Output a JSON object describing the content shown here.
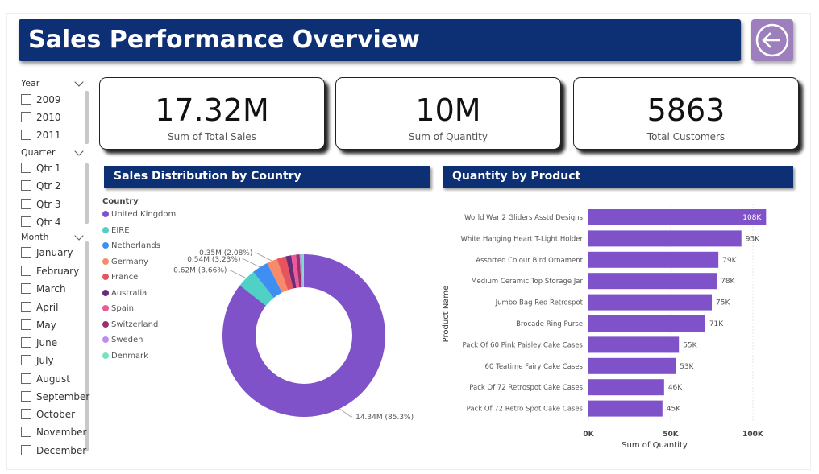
{
  "header": {
    "title": "Sales Performance Overview",
    "back_icon": "arrow-left-circle-icon"
  },
  "colors": {
    "navy": "#0d2f73",
    "purple": "#7f52c9",
    "button": "#9d7fbd"
  },
  "slicers": {
    "year": {
      "label": "Year",
      "items": [
        "2009",
        "2010",
        "2011"
      ]
    },
    "quarter": {
      "label": "Quarter",
      "items": [
        "Qtr 1",
        "Qtr 2",
        "Qtr 3",
        "Qtr 4"
      ]
    },
    "month": {
      "label": "Month",
      "items": [
        "January",
        "February",
        "March",
        "April",
        "May",
        "June",
        "July",
        "August",
        "September",
        "October",
        "November",
        "December"
      ]
    }
  },
  "kpis": [
    {
      "value": "17.32M",
      "label": "Sum of Total Sales"
    },
    {
      "value": "10M",
      "label": "Sum of Quantity"
    },
    {
      "value": "5863",
      "label": "Total Customers"
    }
  ],
  "sections": {
    "donut_title": "Sales Distribution by Country",
    "bar_title": "Quantity by Product"
  },
  "chart_data": [
    {
      "type": "pie",
      "title": "Sales Distribution by Country",
      "legend_title": "Country",
      "legend_position": "left",
      "categories": [
        "United Kingdom",
        "EIRE",
        "Netherlands",
        "Germany",
        "France",
        "Australia",
        "Spain",
        "Switzerland",
        "Sweden",
        "Denmark"
      ],
      "values": [
        14.34,
        0.62,
        0.54,
        0.35,
        0.3,
        0.18,
        0.16,
        0.12,
        0.08,
        0.06
      ],
      "percent": [
        85.3,
        3.66,
        3.23,
        2.08,
        1.78,
        1.07,
        0.95,
        0.71,
        0.48,
        0.36
      ],
      "colors": [
        "#7f52c9",
        "#4fd1c5",
        "#3f8ef2",
        "#f88a6c",
        "#e8545e",
        "#6b2a7a",
        "#ee5a96",
        "#9b2f6f",
        "#c08cf0",
        "#7be1c3"
      ],
      "data_labels": [
        {
          "category": "United Kingdom",
          "text": "14.34M (85.3%)"
        },
        {
          "category": "EIRE",
          "text": "0.62M (3.66%)"
        },
        {
          "category": "Netherlands",
          "text": "0.54M (3.23%)"
        },
        {
          "category": "Germany",
          "text": "0.35M (2.08%)"
        }
      ]
    },
    {
      "type": "bar",
      "orientation": "horizontal",
      "title": "Quantity by Product",
      "xlabel": "Sum of Quantity",
      "ylabel": "Product Name",
      "xlim": [
        0,
        100000
      ],
      "x_ticks": [
        "0K",
        "50K",
        "100K"
      ],
      "categories": [
        "World War 2 Gliders Asstd Designs",
        "White Hanging Heart T-Light Holder",
        "Assorted Colour Bird Ornament",
        "Medium Ceramic Top Storage Jar",
        "Jumbo Bag Red Retrospot",
        "Brocade Ring Purse",
        "Pack Of 60 Pink Paisley Cake Cases",
        "60 Teatime Fairy Cake Cases",
        "Pack Of 72 Retrospot Cake Cases",
        "Pack Of 72 Retro Spot Cake Cases"
      ],
      "values": [
        108000,
        93000,
        79000,
        78000,
        75000,
        71000,
        55000,
        53000,
        46000,
        45000
      ],
      "value_labels": [
        "108K",
        "93K",
        "79K",
        "78K",
        "75K",
        "71K",
        "55K",
        "53K",
        "46K",
        "45K"
      ],
      "color": "#7f52c9"
    }
  ]
}
